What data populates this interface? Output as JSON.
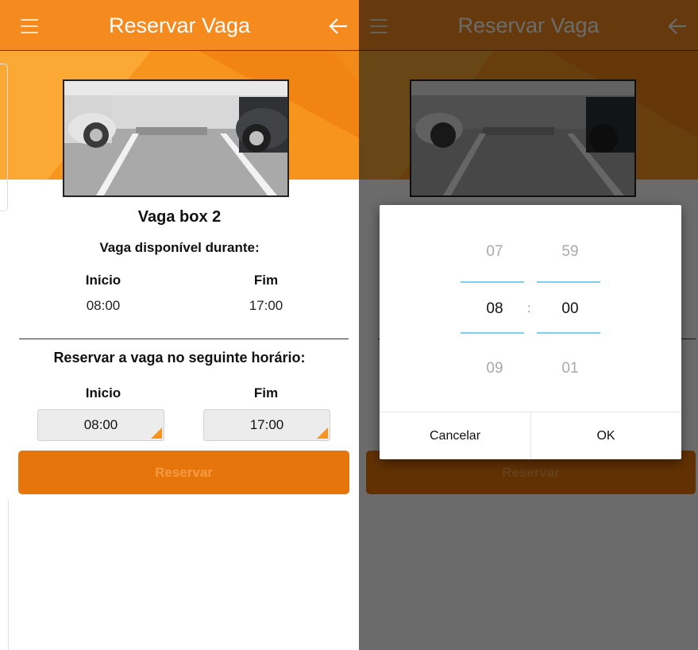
{
  "app_bar": {
    "title": "Reservar Vaga",
    "menu_icon": "hamburger-menu-icon",
    "back_icon": "arrow-left-icon"
  },
  "colors": {
    "primary": "#f58a1f",
    "button": "#e6760b",
    "picker_line": "#7fcff0"
  },
  "parking": {
    "title": "Vaga box 2",
    "available_heading": "Vaga disponível durante:",
    "available_start_label": "Inicio",
    "available_end_label": "Fim",
    "available_start": "08:00",
    "available_end": "17:00"
  },
  "reservation": {
    "heading": "Reservar a vaga no seguinte horário:",
    "start_label": "Inicio",
    "end_label": "Fim",
    "start_value": "08:00",
    "end_value": "17:00",
    "button_label": "Reservar"
  },
  "time_picker": {
    "hour_prev": "07",
    "hour_selected": "08",
    "hour_next": "09",
    "minute_prev": "59",
    "minute_selected": "00",
    "minute_next": "01",
    "separator": ":",
    "cancel_label": "Cancelar",
    "ok_label": "OK"
  }
}
